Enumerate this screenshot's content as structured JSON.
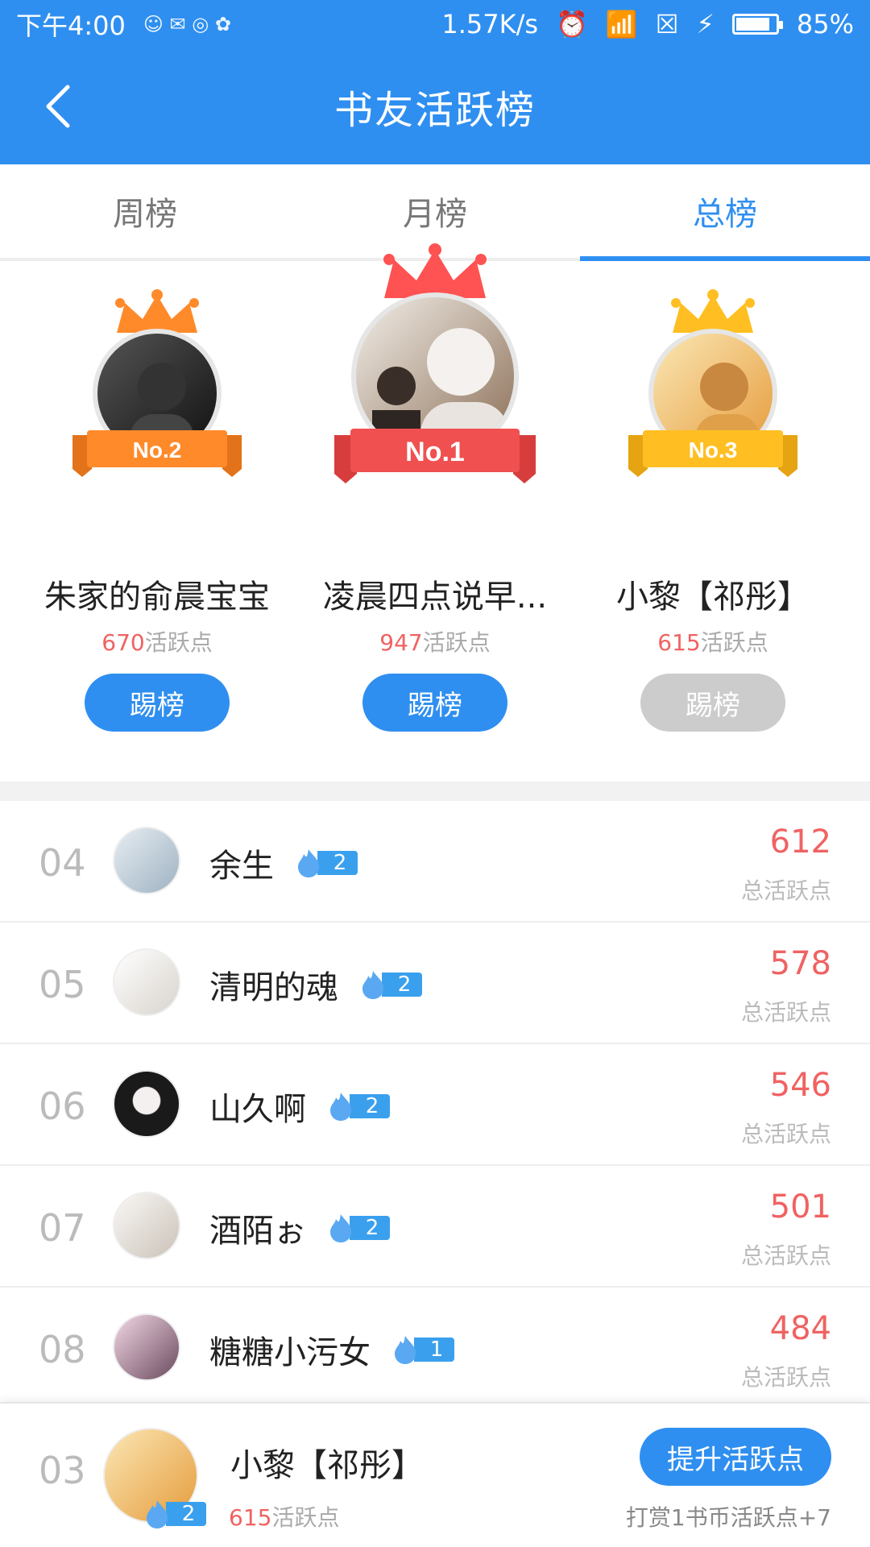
{
  "status_bar": {
    "time": "下午4:00",
    "speed": "1.57K/s",
    "battery": "85%",
    "battery_level": 0.85
  },
  "header": {
    "title": "书友活跃榜"
  },
  "tabs": [
    {
      "label": "周榜",
      "active": false
    },
    {
      "label": "月榜",
      "active": false
    },
    {
      "label": "总榜",
      "active": true
    }
  ],
  "podium": {
    "first": {
      "badge": "No.1",
      "name": "凌晨四点说早...",
      "points": "947",
      "unit": "活跃点",
      "button": "踢榜",
      "crown_color": "#ff5252"
    },
    "second": {
      "badge": "No.2",
      "name": "朱家的俞晨宝宝",
      "points": "670",
      "unit": "活跃点",
      "button": "踢榜",
      "crown_color": "#ff8a2a"
    },
    "third": {
      "badge": "No.3",
      "name": "小黎【祁彤】",
      "points": "615",
      "unit": "活跃点",
      "button": "踢榜",
      "crown_color": "#ffbf22"
    }
  },
  "list": [
    {
      "rank": "04",
      "name": "余生",
      "level": "2",
      "points": "612",
      "label": "总活跃点"
    },
    {
      "rank": "05",
      "name": "清明的魂",
      "level": "2",
      "points": "578",
      "label": "总活跃点"
    },
    {
      "rank": "06",
      "name": "山久啊",
      "level": "2",
      "points": "546",
      "label": "总活跃点"
    },
    {
      "rank": "07",
      "name": "酒陌ぉ",
      "level": "2",
      "points": "501",
      "label": "总活跃点"
    },
    {
      "rank": "08",
      "name": "糖糖小污女",
      "level": "1",
      "points": "484",
      "label": "总活跃点"
    }
  ],
  "my_rank": {
    "rank": "03",
    "name": "小黎【祁彤】",
    "level": "2",
    "points": "615",
    "unit": "活跃点",
    "button": "提升活跃点",
    "tip": "打赏1书币活跃点+7"
  },
  "colors": {
    "primary": "#2f8ff0",
    "points": "#f06262",
    "disabled": "#cccccc"
  }
}
